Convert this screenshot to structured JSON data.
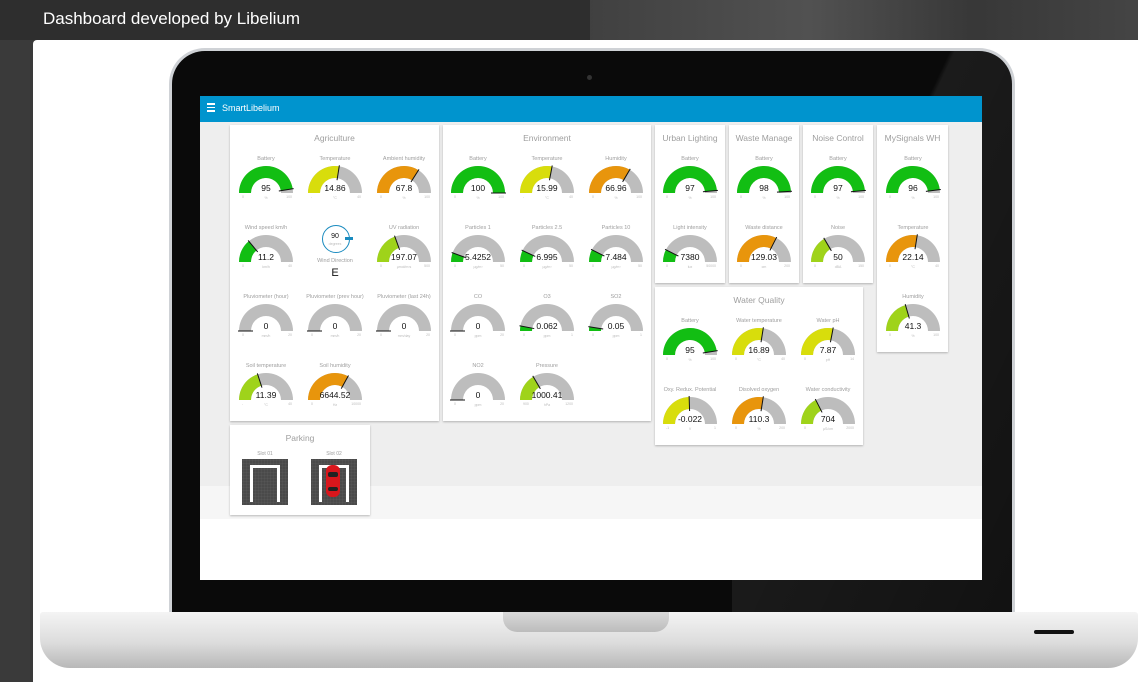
{
  "caption": "Dashboard developed by Libelium",
  "app": {
    "title": "SmartLibelium",
    "accent": "#0094ce"
  },
  "colors": {
    "green": "#12be13",
    "yellow": "#d8dd0c",
    "orange": "#e8950c",
    "lime": "#9fd31a",
    "track": "#bdbdbd"
  },
  "panels": {
    "agriculture": {
      "title": "Agriculture",
      "gauges": [
        {
          "label": "Battery",
          "value": "95",
          "unit": "%",
          "min": "0",
          "max": "100",
          "fraction": 0.95,
          "color": "green"
        },
        {
          "label": "Temperature",
          "value": "14.86",
          "unit": "°C",
          "min": "-",
          "max": "40",
          "fraction": 0.55,
          "color": "yellow"
        },
        {
          "label": "Ambient humidity",
          "value": "67.8",
          "unit": "%",
          "min": "0",
          "max": "100",
          "fraction": 0.68,
          "color": "orange"
        },
        {
          "label": "Wind speed km/h",
          "value": "11.2",
          "unit": "km/h",
          "min": "0",
          "max": "40",
          "fraction": 0.28,
          "color": "green"
        },
        {
          "label": "UV radiation",
          "value": "197.07",
          "unit": "µmol/m²s",
          "min": "0",
          "max": "500",
          "fraction": 0.39,
          "color": "lime"
        },
        {
          "label": "Pluviometer (hour)",
          "value": "0",
          "unit": "mm/h",
          "min": "0",
          "max": "20",
          "fraction": 0.0,
          "color": "green"
        },
        {
          "label": "Pluviometer (prev hour)",
          "value": "0",
          "unit": "mm/h",
          "min": "0",
          "max": "20",
          "fraction": 0.0,
          "color": "green"
        },
        {
          "label": "Pluviometer (last 24h)",
          "value": "0",
          "unit": "mm/day",
          "min": "0",
          "max": "20",
          "fraction": 0.0,
          "color": "green"
        },
        {
          "label": "Soil temperature",
          "value": "11.39",
          "unit": "°C",
          "min": "-",
          "max": "40",
          "fraction": 0.4,
          "color": "lime"
        },
        {
          "label": "Soil humidity",
          "value": "6644.52",
          "unit": "Hz",
          "min": "0",
          "max": "10000",
          "fraction": 0.66,
          "color": "orange"
        }
      ],
      "wind": {
        "value": "90",
        "unit": "degrees",
        "label": "Wind Direction",
        "direction": "E"
      }
    },
    "environment": {
      "title": "Environment",
      "gauges": [
        {
          "label": "Battery",
          "value": "100",
          "unit": "%",
          "min": "0",
          "max": "100",
          "fraction": 1.0,
          "color": "green"
        },
        {
          "label": "Temperature",
          "value": "15.99",
          "unit": "°C",
          "min": "-",
          "max": "40",
          "fraction": 0.56,
          "color": "yellow"
        },
        {
          "label": "Humidity",
          "value": "66.96",
          "unit": "%",
          "min": "0",
          "max": "100",
          "fraction": 0.67,
          "color": "orange"
        },
        {
          "label": "Particles 1",
          "value": "5.4252",
          "unit": "µg/m³",
          "min": "0",
          "max": "50",
          "fraction": 0.11,
          "color": "green"
        },
        {
          "label": "Particles 2.5",
          "value": "6.995",
          "unit": "µg/m³",
          "min": "0",
          "max": "50",
          "fraction": 0.14,
          "color": "green"
        },
        {
          "label": "Particles 10",
          "value": "7.484",
          "unit": "µg/m³",
          "min": "0",
          "max": "50",
          "fraction": 0.15,
          "color": "green"
        },
        {
          "label": "CO",
          "value": "0",
          "unit": "ppm",
          "min": "0",
          "max": "20",
          "fraction": 0.0,
          "color": "green"
        },
        {
          "label": "O3",
          "value": "0.062",
          "unit": "ppm",
          "min": "0",
          "max": "1",
          "fraction": 0.06,
          "color": "green"
        },
        {
          "label": "SO2",
          "value": "0.05",
          "unit": "ppm",
          "min": "0",
          "max": "1",
          "fraction": 0.05,
          "color": "green"
        },
        {
          "label": "NO2",
          "value": "0",
          "unit": "ppm",
          "min": "0",
          "max": "20",
          "fraction": 0.0,
          "color": "green"
        },
        {
          "label": "Pressure",
          "value": "1000.41",
          "unit": "hPa",
          "min": "900",
          "max": "1200",
          "fraction": 0.33,
          "color": "lime"
        }
      ]
    },
    "urban": {
      "title": "Urban Lighting",
      "gauges": [
        {
          "label": "Battery",
          "value": "97",
          "unit": "%",
          "min": "0",
          "max": "100",
          "fraction": 0.97,
          "color": "green"
        },
        {
          "label": "Light intensity",
          "value": "7380",
          "unit": "lux",
          "min": "0",
          "max": "50000",
          "fraction": 0.15,
          "color": "green"
        }
      ]
    },
    "waste": {
      "title": "Waste Manage",
      "gauges": [
        {
          "label": "Battery",
          "value": "98",
          "unit": "%",
          "min": "0",
          "max": "100",
          "fraction": 0.98,
          "color": "green"
        },
        {
          "label": "Waste distance",
          "value": "129.03",
          "unit": "cm",
          "min": "0",
          "max": "200",
          "fraction": 0.65,
          "color": "orange"
        }
      ]
    },
    "noise": {
      "title": "Noise Control",
      "gauges": [
        {
          "label": "Battery",
          "value": "97",
          "unit": "%",
          "min": "0",
          "max": "100",
          "fraction": 0.97,
          "color": "green"
        },
        {
          "label": "Noise",
          "value": "50",
          "unit": "dBA",
          "min": "0",
          "max": "150",
          "fraction": 0.33,
          "color": "lime"
        }
      ]
    },
    "mysignals": {
      "title": "MySignals WH",
      "gauges": [
        {
          "label": "Battery",
          "value": "96",
          "unit": "%",
          "min": "0",
          "max": "100",
          "fraction": 0.96,
          "color": "green"
        },
        {
          "label": "Temperature",
          "value": "22.14",
          "unit": "°C",
          "min": "0",
          "max": "40",
          "fraction": 0.55,
          "color": "orange"
        },
        {
          "label": "Humidity",
          "value": "41.3",
          "unit": "%",
          "min": "0",
          "max": "100",
          "fraction": 0.41,
          "color": "lime"
        }
      ]
    },
    "water": {
      "title": "Water Quality",
      "gauges": [
        {
          "label": "Battery",
          "value": "95",
          "unit": "%",
          "min": "0",
          "max": "100",
          "fraction": 0.95,
          "color": "green"
        },
        {
          "label": "Water temperature",
          "value": "16.89",
          "unit": "°C",
          "min": "0",
          "max": "40",
          "fraction": 0.55,
          "color": "yellow"
        },
        {
          "label": "Water pH",
          "value": "7.87",
          "unit": "pH",
          "min": "0",
          "max": "14",
          "fraction": 0.56,
          "color": "yellow"
        },
        {
          "label": "Oxy. Redux. Potential",
          "value": "-0.022",
          "unit": "V",
          "min": "-1",
          "max": "1",
          "fraction": 0.49,
          "color": "yellow"
        },
        {
          "label": "Disolved oxygen",
          "value": "110.3",
          "unit": "%",
          "min": "0",
          "max": "200",
          "fraction": 0.55,
          "color": "orange"
        },
        {
          "label": "Water conductivity",
          "value": "704",
          "unit": "µS/cm",
          "min": "0",
          "max": "2000",
          "fraction": 0.35,
          "color": "lime"
        }
      ]
    },
    "parking": {
      "title": "Parking",
      "slots": [
        {
          "label": "Slot 01",
          "occupied": false
        },
        {
          "label": "Slot 02",
          "occupied": true
        }
      ]
    }
  }
}
